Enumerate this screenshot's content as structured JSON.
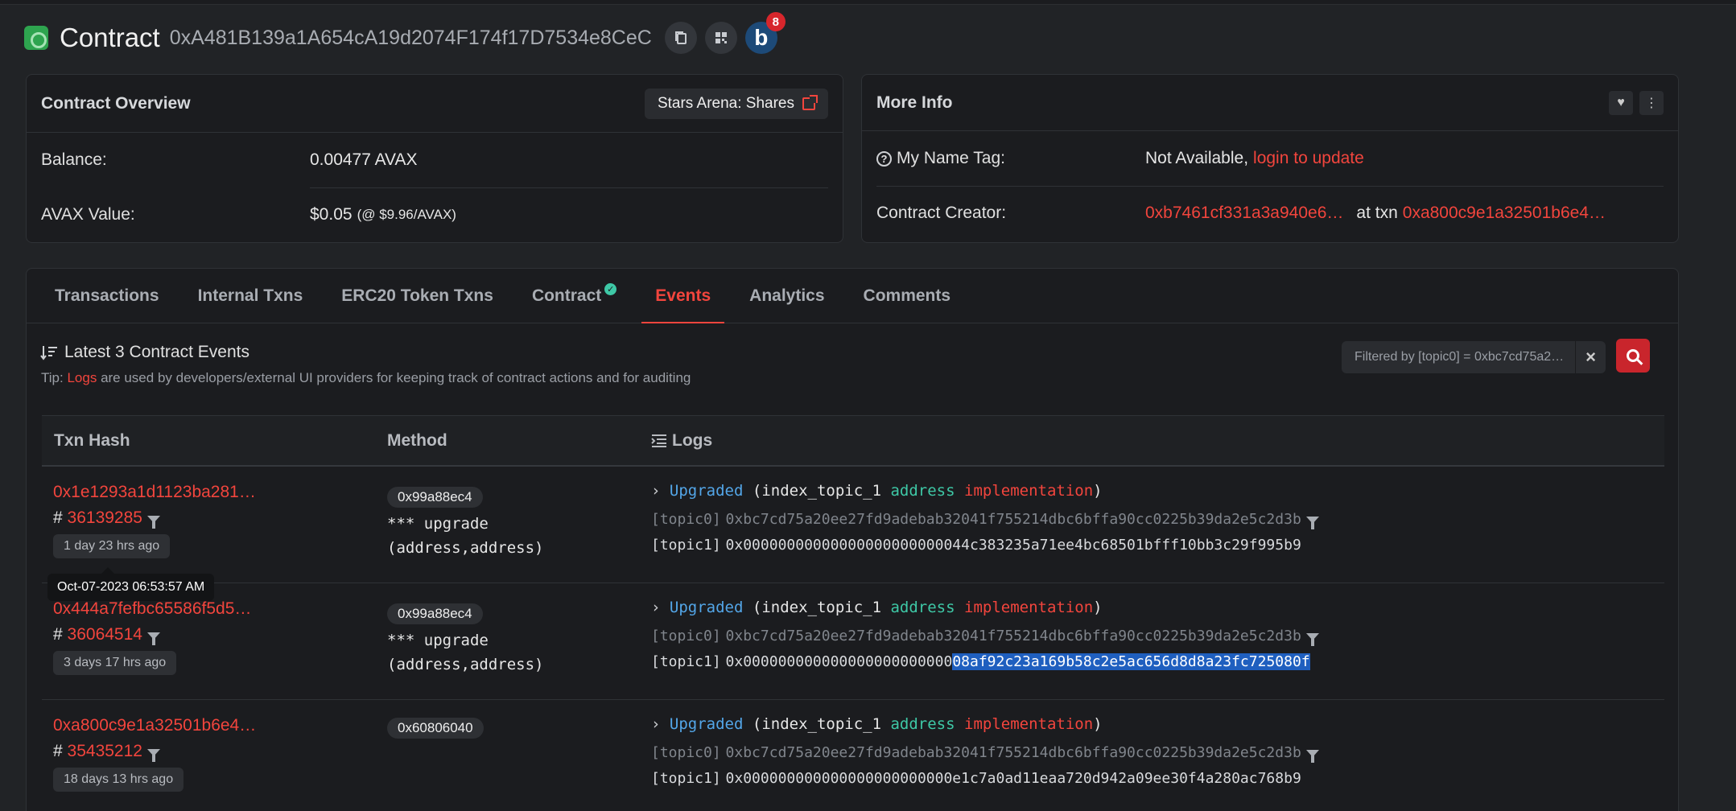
{
  "header": {
    "title": "Contract",
    "address": "0xA481B139a1A654cA19d2074F174f17D7534e8CeC",
    "badge_letter": "b",
    "badge_count": "8"
  },
  "overview": {
    "title": "Contract Overview",
    "tag_label": "Stars Arena: Shares",
    "balance_label": "Balance:",
    "balance_value": "0.00477 AVAX",
    "value_label": "AVAX Value:",
    "value_amount": "$0.05",
    "value_rate": "(@ $9.96/AVAX)"
  },
  "more_info": {
    "title": "More Info",
    "name_tag_label": "My Name Tag:",
    "name_tag_value": "Not Available,",
    "name_tag_link": "login to update",
    "creator_label": "Contract Creator:",
    "creator_address": "0xb7461cf331a3a940e6…",
    "creator_at": "at txn",
    "creator_txn": "0xa800c9e1a32501b6e4…"
  },
  "tabs": [
    {
      "label": "Transactions"
    },
    {
      "label": "Internal Txns"
    },
    {
      "label": "ERC20 Token Txns"
    },
    {
      "label": "Contract"
    },
    {
      "label": "Events"
    },
    {
      "label": "Analytics"
    },
    {
      "label": "Comments"
    }
  ],
  "events": {
    "heading": "Latest 3 Contract Events",
    "tip_prefix": "Tip:",
    "tip_link": "Logs",
    "tip_text": "are used by developers/external UI providers for keeping track of contract actions and for auditing",
    "filter_text": "Filtered by [topic0] = 0xbc7cd75a2…",
    "columns": {
      "txn_hash": "Txn Hash",
      "method": "Method",
      "logs": "Logs"
    },
    "tooltip": "Oct-07-2023 06:53:57 AM",
    "rows": [
      {
        "hash": "0x1e1293a1d1123ba281…",
        "block_prefix": "#",
        "block": "36139285",
        "age": "1 day 23 hrs ago",
        "method_id": "0x99a88ec4",
        "method_stars": "*** upgrade",
        "method_sig": "(address,address)",
        "event": "Upgraded",
        "p_open": "(index_topic_1",
        "p_type": "address",
        "p_name": "implementation",
        "p_close": ")",
        "topic0_label": "[topic0]",
        "topic0": "0xbc7cd75a20ee27fd9adebab32041f755214dbc6bffa90cc0225b39da2e5c2d3b",
        "topic1_label": "[topic1]",
        "topic1": "0x00000000000000000000000044c383235a71ee4bc68501bfff10bb3c29f995b9",
        "topic1_plain": "",
        "topic1_hl": ""
      },
      {
        "hash": "0x444a7fefbc65586f5d5…",
        "block_prefix": "#",
        "block": "36064514",
        "age": "3 days 17 hrs ago",
        "method_id": "0x99a88ec4",
        "method_stars": "*** upgrade",
        "method_sig": "(address,address)",
        "event": "Upgraded",
        "p_open": "(index_topic_1",
        "p_type": "address",
        "p_name": "implementation",
        "p_close": ")",
        "topic0_label": "[topic0]",
        "topic0": "0xbc7cd75a20ee27fd9adebab32041f755214dbc6bffa90cc0225b39da2e5c2d3b",
        "topic1_label": "[topic1]",
        "topic1": "",
        "topic1_plain": "0x000000000000000000000000",
        "topic1_hl": "08af92c23a169b58c2e5ac656d8d8a23fc725080f"
      },
      {
        "hash": "0xa800c9e1a32501b6e4…",
        "block_prefix": "#",
        "block": "35435212",
        "age": "18 days 13 hrs ago",
        "method_id": "0x60806040",
        "method_stars": "",
        "method_sig": "",
        "event": "Upgraded",
        "p_open": "(index_topic_1",
        "p_type": "address",
        "p_name": "implementation",
        "p_close": ")",
        "topic0_label": "[topic0]",
        "topic0": "0xbc7cd75a20ee27fd9adebab32041f755214dbc6bffa90cc0225b39da2e5c2d3b",
        "topic1_label": "[topic1]",
        "topic1": "0x000000000000000000000000e1c7a0ad11eaa720d942a09ee30f4a280ac768b9",
        "topic1_plain": "",
        "topic1_hl": ""
      }
    ]
  }
}
